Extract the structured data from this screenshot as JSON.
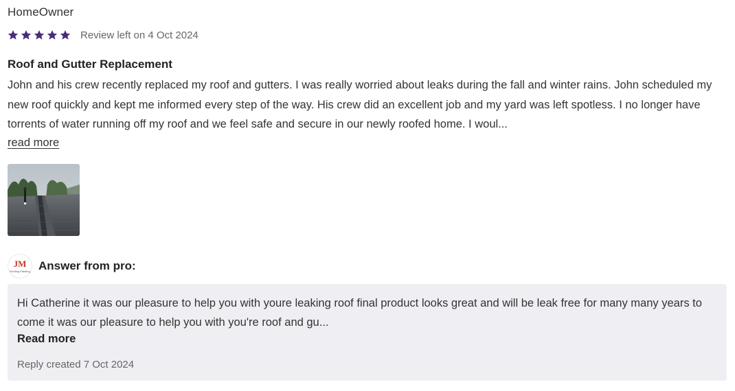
{
  "review": {
    "reviewer_name": "HomeOwner",
    "rating": 5,
    "rating_max": 5,
    "star_color": "#4a2c7d",
    "date_text": "Review left on 4 Oct 2024",
    "title": "Roof and Gutter Replacement",
    "body": "John and his crew recently replaced my roof and gutters. I was really worried about leaks during the fall and winter rains. John scheduled my new roof quickly and kept me informed every step of the way. His crew did an excellent job and my yard was left spotless.  I no longer have torrents of water running off my roof and we feel safe and secure in our newly roofed home. I woul...",
    "read_more_label": "read more",
    "photo_icon": "roof-photo"
  },
  "pro_reply": {
    "logo_text": "JM",
    "logo_subtext": "Roofing Painting",
    "label": "Answer from pro:",
    "text": "Hi Catherine it was our pleasure to help you with youre leaking roof final product looks great and will be leak free for many many years to come it was our pleasure to help you with you're roof and gu...",
    "read_more_label": "Read more",
    "date_text": "Reply created 7 Oct 2024",
    "background_color": "#efeff3"
  }
}
